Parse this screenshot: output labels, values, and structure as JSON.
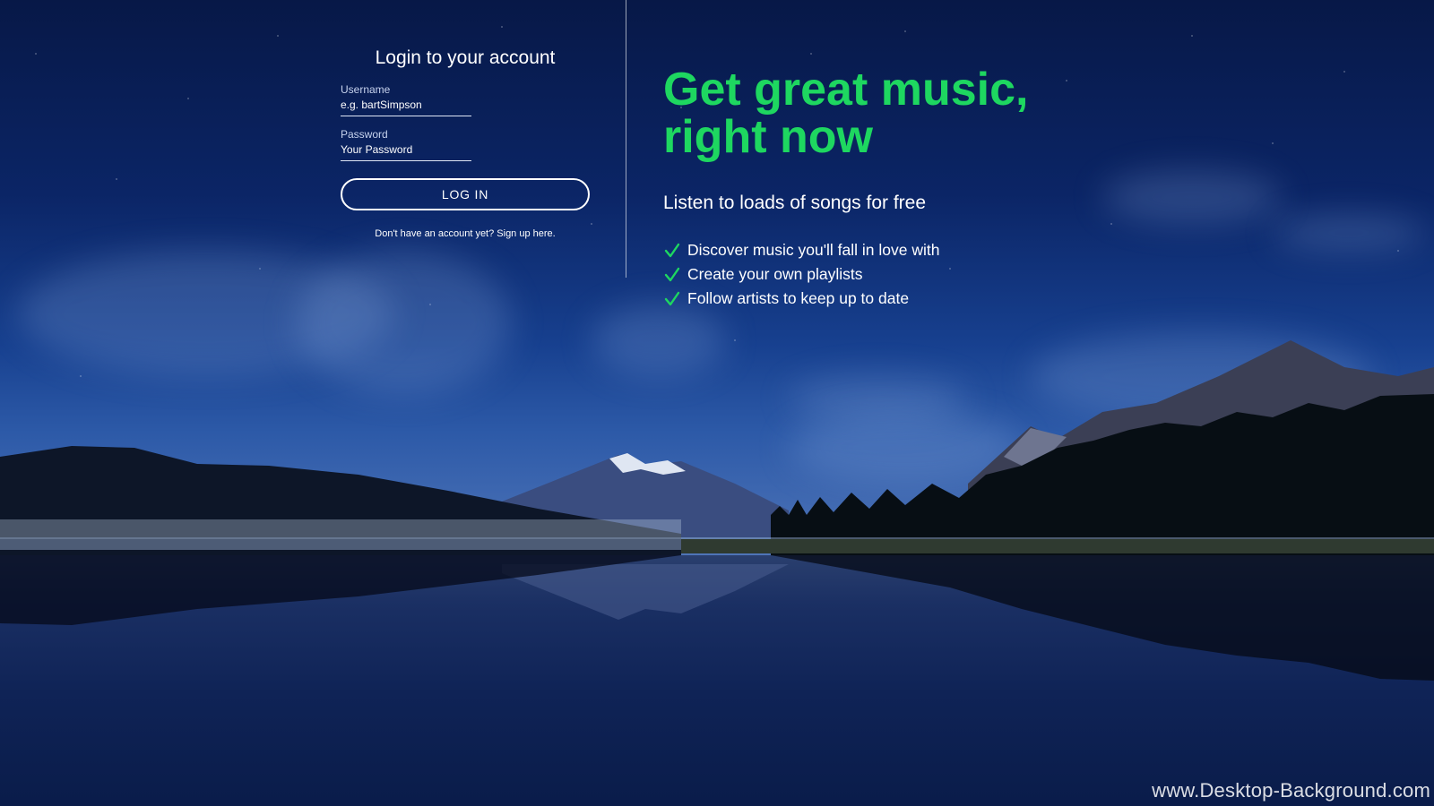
{
  "login": {
    "title": "Login to your account",
    "username_label": "Username",
    "username_placeholder": "e.g. bartSimpson",
    "password_label": "Password",
    "password_placeholder": "Your Password",
    "login_button": "LOG IN",
    "signup_text": "Don't have an account yet? Sign up here."
  },
  "promo": {
    "headline_line1": "Get great music,",
    "headline_line2": "right now",
    "subheading": "Listen to loads of songs for free",
    "features": [
      "Discover music you'll fall in love with",
      "Create your own playlists",
      "Follow artists to keep up to date"
    ]
  },
  "watermark": "www.Desktop-Background.com",
  "colors": {
    "accent": "#1ed760",
    "text": "#ffffff",
    "sky": "#0b2566"
  },
  "icons": {
    "feature_bullet": "check-icon"
  }
}
